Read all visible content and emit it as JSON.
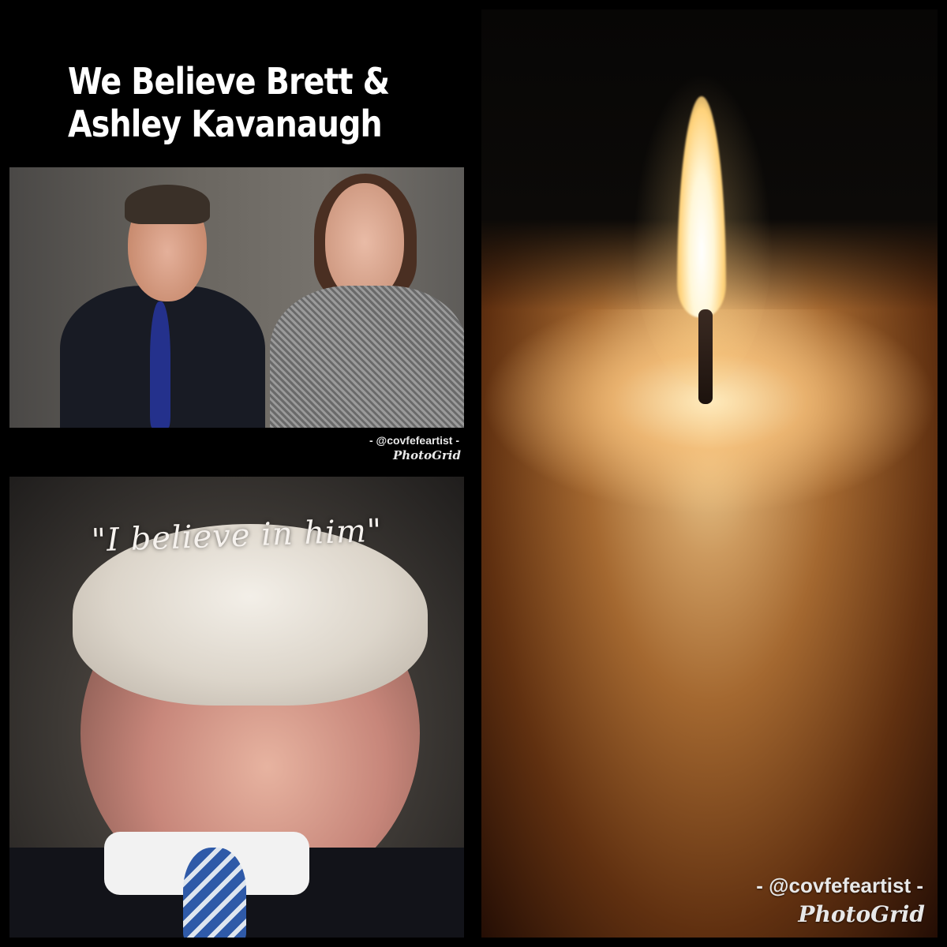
{
  "title": {
    "line1": "We Believe Brett &",
    "line2": "Ashley Kavanaugh"
  },
  "quote": "\"I believe in him\"",
  "watermarks": {
    "top_handle": "- @covfefeartist -",
    "top_app": "PhotoGrid",
    "bottom_handle": "- @covfefeartist -",
    "bottom_app": "PhotoGrid"
  },
  "colors": {
    "background": "#000000",
    "title": "#ffffff",
    "flame": "#ffffff",
    "candle_wax": "#d59a5a"
  }
}
